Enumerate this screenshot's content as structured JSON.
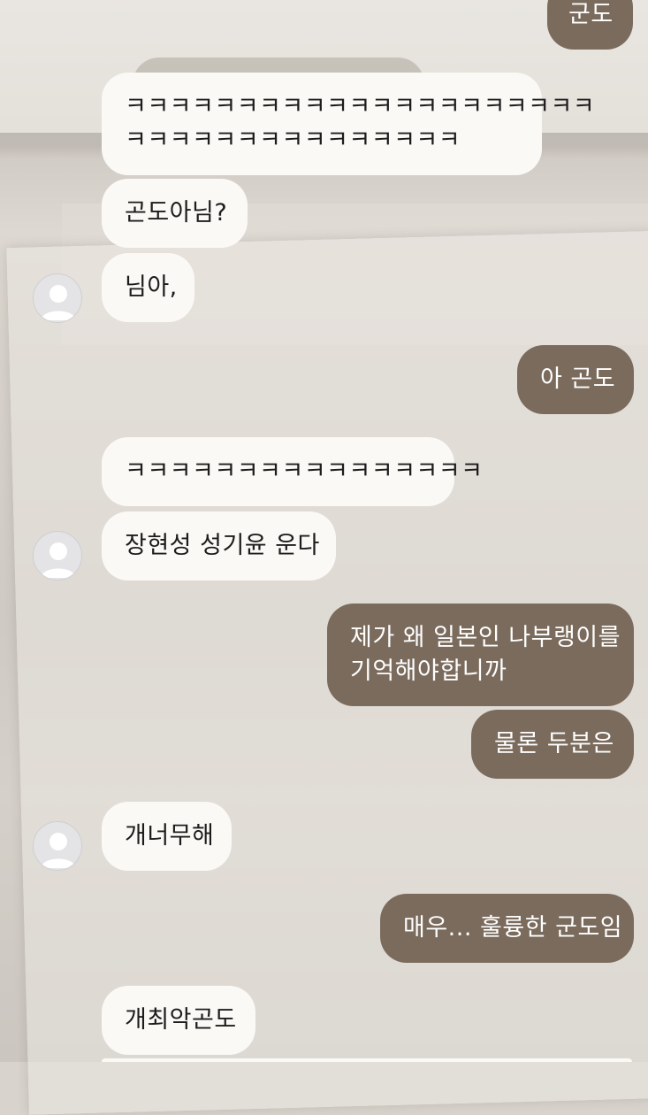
{
  "colors": {
    "incoming_bubble": "#fbf9f6",
    "outgoing_bubble": "#7a6b5d",
    "incoming_text": "#1c1c1c",
    "outgoing_text": "#ffffff"
  },
  "messages": [
    {
      "id": 1,
      "side": "outgoing",
      "lines": [
        "군도"
      ]
    },
    {
      "id": 2,
      "side": "incoming",
      "lines": [
        "ㅋㅋㅋㅋㅋㅋㅋㅋㅋㅋㅋㅋㅋㅋㅋㅋㅋㅋㅋㅋㅋ",
        "ㅋㅋㅋㅋㅋㅋㅋㅋㅋㅋㅋㅋㅋㅋㅋ"
      ]
    },
    {
      "id": 3,
      "side": "incoming",
      "lines": [
        "곤도아님?"
      ]
    },
    {
      "id": 4,
      "side": "incoming",
      "lines": [
        "님아,"
      ],
      "avatar": "default-profile-icon"
    },
    {
      "id": 5,
      "side": "outgoing",
      "lines": [
        "아 곤도"
      ]
    },
    {
      "id": 6,
      "side": "incoming",
      "lines": [
        "ㅋㅋㅋㅋㅋㅋㅋㅋㅋㅋㅋㅋㅋㅋㅋㅋ"
      ]
    },
    {
      "id": 7,
      "side": "incoming",
      "lines": [
        "장현성 성기윤 운다"
      ],
      "avatar": "default-profile-icon"
    },
    {
      "id": 8,
      "side": "outgoing",
      "lines": [
        "제가 왜 일본인 나부랭이를",
        "기억해야합니까"
      ]
    },
    {
      "id": 9,
      "side": "outgoing",
      "lines": [
        "물론 두분은"
      ]
    },
    {
      "id": 10,
      "side": "incoming",
      "lines": [
        "개너무해"
      ],
      "avatar": "default-profile-icon"
    },
    {
      "id": 11,
      "side": "outgoing",
      "lines": [
        "매우... 훌륭한 군도임"
      ]
    },
    {
      "id": 12,
      "side": "incoming",
      "lines": [
        "개최악곤도"
      ]
    }
  ]
}
